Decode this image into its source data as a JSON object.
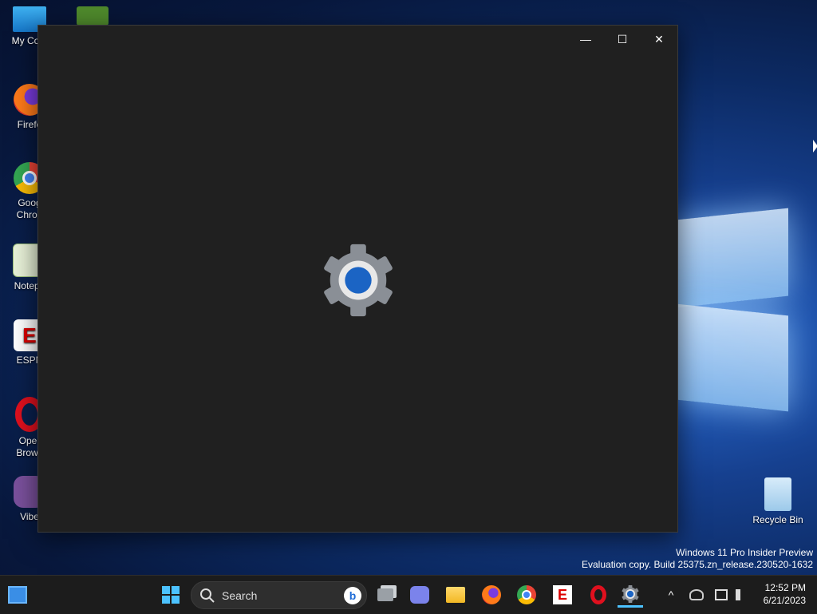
{
  "desktop": {
    "icons": [
      {
        "label": "My Com"
      },
      {
        "label": "Firefo"
      },
      {
        "label": "Goog",
        "label2": "Chron"
      },
      {
        "label": "Notepa"
      },
      {
        "label": "ESPN"
      },
      {
        "label": "Oper",
        "label2": "Brows"
      },
      {
        "label": "Vibe"
      },
      {
        "label": "Recycle Bin"
      }
    ],
    "watermark": {
      "line1": "Windows 11 Pro Insider Preview",
      "line2": "Evaluation copy. Build 25375.zn_release.230520-1632"
    }
  },
  "window": {
    "title": "",
    "controls": {
      "minimize": "—",
      "maximize": "☐",
      "close": "✕"
    },
    "splash_icon": "settings-gear-icon"
  },
  "taskbar": {
    "search_placeholder": "Search",
    "bing_label": "b",
    "tray": {
      "chevron": "^"
    },
    "clock": {
      "time": "12:52 PM",
      "date": "6/21/2023"
    }
  },
  "colors": {
    "accent": "#1e6bd6",
    "window_bg": "#202020",
    "taskbar_bg": "#1c1c1c"
  }
}
